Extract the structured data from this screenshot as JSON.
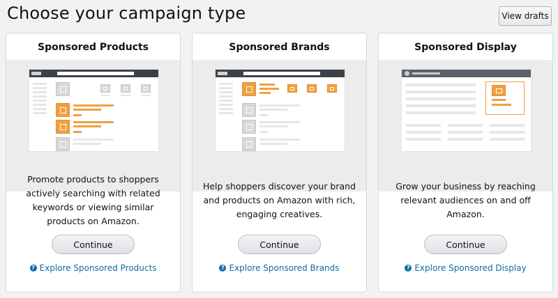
{
  "header": {
    "title": "Choose your campaign type",
    "view_drafts_label": "View drafts"
  },
  "cards": [
    {
      "title": "Sponsored Products",
      "description": "Promote products to shoppers actively searching with related keywords or viewing similar products on Amazon.",
      "continue_label": "Continue",
      "explore_label": "Explore Sponsored Products"
    },
    {
      "title": "Sponsored Brands",
      "description": "Help shoppers discover your brand and products on Amazon with rich, engaging creatives.",
      "continue_label": "Continue",
      "explore_label": "Explore Sponsored Brands"
    },
    {
      "title": "Sponsored Display",
      "description": "Grow your business by reaching relevant audiences on and off Amazon.",
      "continue_label": "Continue",
      "explore_label": "Explore Sponsored Display"
    }
  ],
  "colors": {
    "accent_orange": "#f0a040",
    "link_blue": "#0f6ba6",
    "page_background": "#f2f2f2"
  },
  "icons": {
    "help": "question-circle-icon"
  }
}
